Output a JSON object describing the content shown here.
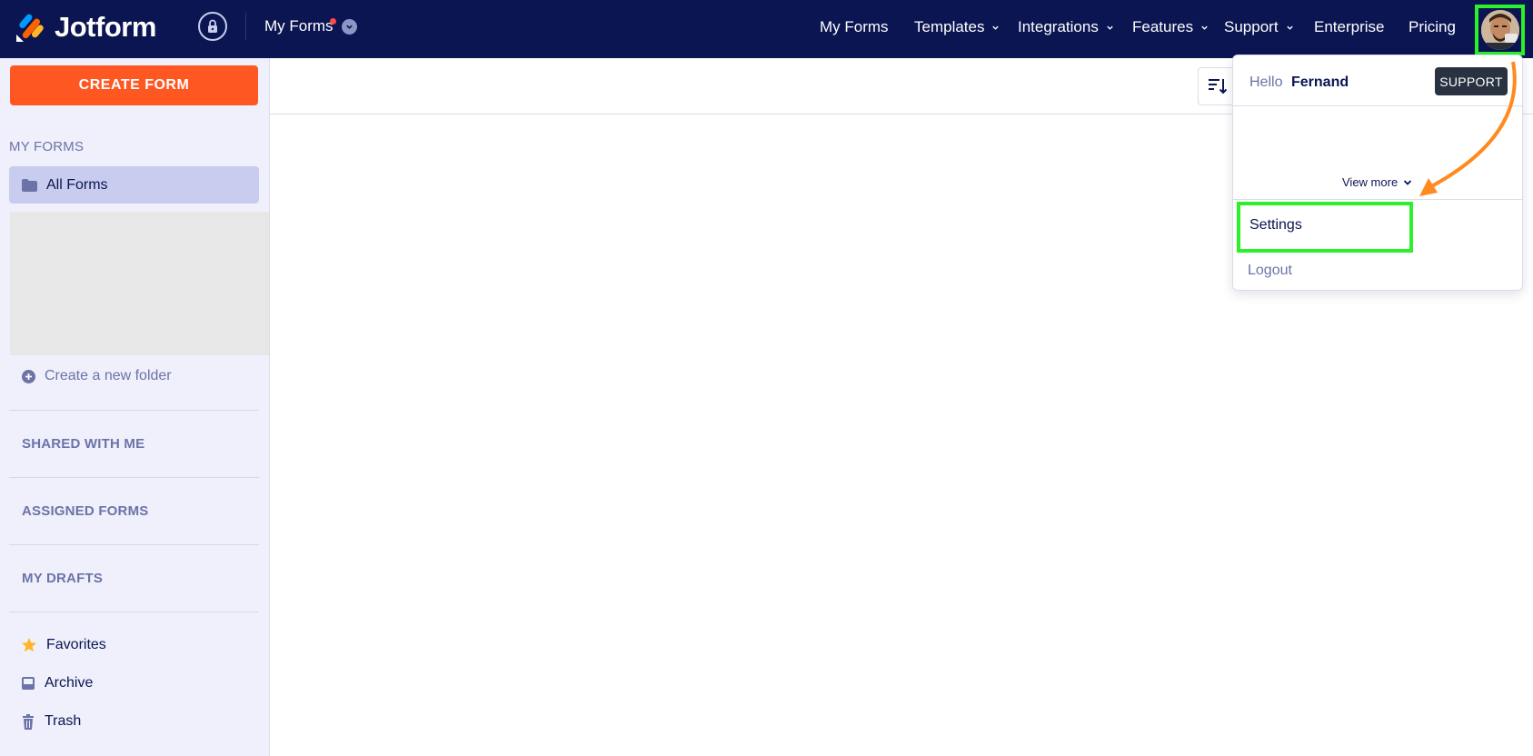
{
  "brand": {
    "name": "Jotform"
  },
  "header": {
    "section_title": "My Forms",
    "nav": [
      {
        "label": "My Forms",
        "has_caret": false
      },
      {
        "label": "Templates",
        "has_caret": true
      },
      {
        "label": "Integrations",
        "has_caret": true
      },
      {
        "label": "Features",
        "has_caret": true
      },
      {
        "label": "Support",
        "has_caret": true
      },
      {
        "label": "Enterprise",
        "has_caret": false
      },
      {
        "label": "Pricing",
        "has_caret": false
      }
    ]
  },
  "sidebar": {
    "create_button": "CREATE FORM",
    "my_forms_heading": "MY FORMS",
    "all_forms": "All Forms",
    "create_folder": "Create a new folder",
    "shared_heading": "SHARED WITH ME",
    "assigned_heading": "ASSIGNED FORMS",
    "drafts_heading": "MY DRAFTS",
    "favorites": "Favorites",
    "archive": "Archive",
    "trash": "Trash"
  },
  "account_menu": {
    "greeting": "Hello",
    "user_name": "Fernand",
    "support_badge": "SUPPORT",
    "view_more": "View more",
    "settings": "Settings",
    "logout": "Logout"
  },
  "colors": {
    "nav_bg": "#0a1551",
    "accent_orange": "#ff5722",
    "highlight_green": "#2cf02c",
    "annotation_arrow": "#ff8a1f",
    "sidebar_bg": "#eff0fb"
  }
}
